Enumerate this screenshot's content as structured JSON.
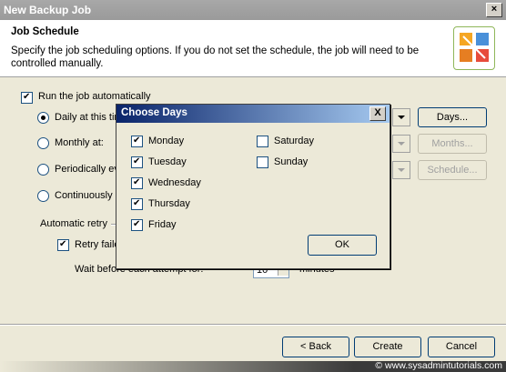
{
  "window": {
    "title": "New Backup Job"
  },
  "header": {
    "title": "Job Schedule",
    "description": "Specify the job scheduling options. If you do not set the schedule, the job will need to be controlled manually."
  },
  "schedule": {
    "run_automatically_label": "Run the job automatically",
    "daily_label": "Daily at this tim",
    "monthly_label": "Monthly at:",
    "periodically_label": "Periodically ev",
    "continuously_label": "Continuously",
    "days_button": "Days...",
    "months_button": "Months...",
    "schedule_button": "Schedule..."
  },
  "retry": {
    "group_label": "Automatic retry",
    "retry_label": "Retry faile",
    "wait_label": "Wait before each attempt for:",
    "wait_value": "10",
    "wait_unit": "minutes"
  },
  "dialog": {
    "title": "Choose Days",
    "days": [
      {
        "label": "Monday",
        "checked": true
      },
      {
        "label": "Tuesday",
        "checked": true
      },
      {
        "label": "Wednesday",
        "checked": true
      },
      {
        "label": "Thursday",
        "checked": true
      },
      {
        "label": "Friday",
        "checked": true
      },
      {
        "label": "Saturday",
        "checked": false
      },
      {
        "label": "Sunday",
        "checked": false
      }
    ],
    "ok_label": "OK",
    "close_label": "X"
  },
  "footer": {
    "back_label": "< Back",
    "create_label": "Create",
    "cancel_label": "Cancel"
  },
  "watermark": "© www.sysadmintutorials.com"
}
